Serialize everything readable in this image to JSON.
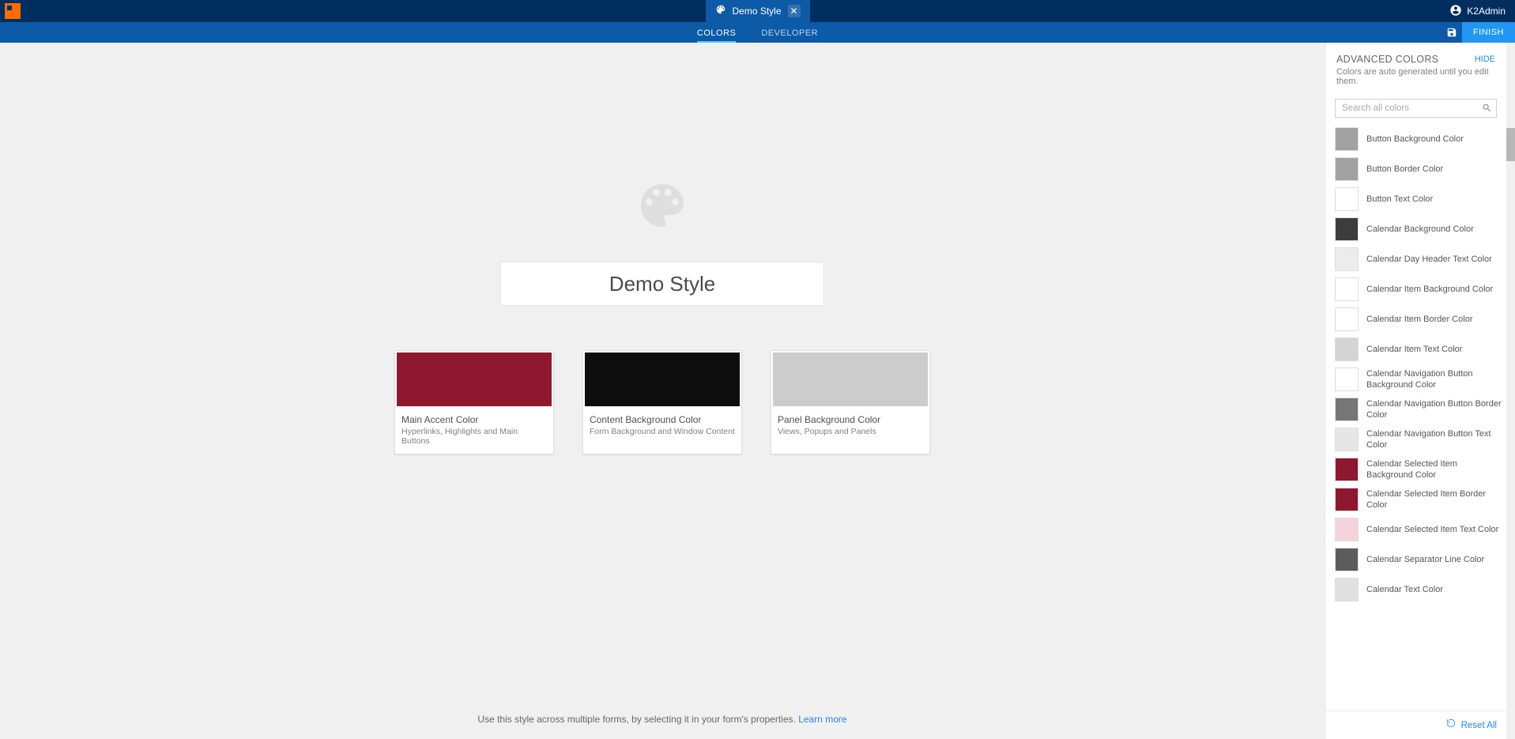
{
  "tab": {
    "label": "Demo Style"
  },
  "user": {
    "name": "K2Admin"
  },
  "nav": {
    "colors": "COLORS",
    "developer": "DEVELOPER",
    "finish": "FINISH"
  },
  "styleName": "Demo Style",
  "mainColors": [
    {
      "title": "Main Accent Color",
      "sub": "Hyperlinks, Highlights and Main Buttons",
      "hex": "#8e1830"
    },
    {
      "title": "Content Background Color",
      "sub": "Form Background and Window Content",
      "hex": "#0d0d0d"
    },
    {
      "title": "Panel Background Color",
      "sub": "Views, Popups and Panels",
      "hex": "#cccccc"
    }
  ],
  "footer": {
    "text": "Use this style across multiple forms, by selecting it in your form's properties. ",
    "link": "Learn more"
  },
  "sidebar": {
    "title": "ADVANCED COLORS",
    "hide": "HIDE",
    "sub": "Colors are auto generated until you edit them.",
    "searchPlaceholder": "Search all colors",
    "reset": "Reset All",
    "items": [
      {
        "label": "Button Background Color",
        "hex": "#a1a1a1"
      },
      {
        "label": "Button Border Color",
        "hex": "#a1a1a1"
      },
      {
        "label": "Button Text Color",
        "hex": "#ffffff"
      },
      {
        "label": "Calendar Background Color",
        "hex": "#3c3c3c"
      },
      {
        "label": "Calendar Day Header Text Color",
        "hex": "#ececec"
      },
      {
        "label": "Calendar Item Background Color",
        "hex": "#ffffff"
      },
      {
        "label": "Calendar Item Border Color",
        "hex": "#ffffff"
      },
      {
        "label": "Calendar Item Text Color",
        "hex": "#d4d4d4"
      },
      {
        "label": "Calendar Navigation Button Background Color",
        "hex": "#ffffff"
      },
      {
        "label": "Calendar Navigation Button Border Color",
        "hex": "#767676"
      },
      {
        "label": "Calendar Navigation Button Text Color",
        "hex": "#e6e6e6"
      },
      {
        "label": "Calendar Selected Item Background Color",
        "hex": "#8e1830"
      },
      {
        "label": "Calendar Selected Item Border Color",
        "hex": "#8e1830"
      },
      {
        "label": "Calendar Selected Item Text Color",
        "hex": "#f6d3da"
      },
      {
        "label": "Calendar Separator Line Color",
        "hex": "#5c5c5c"
      },
      {
        "label": "Calendar Text Color",
        "hex": "#e0e0e0"
      }
    ]
  }
}
